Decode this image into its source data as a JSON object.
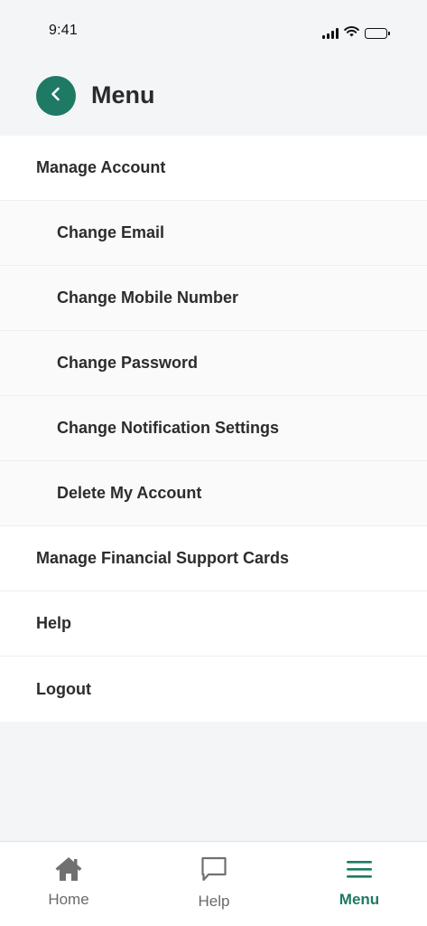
{
  "status_bar": {
    "time": "9:41"
  },
  "header": {
    "title": "Menu"
  },
  "menu": {
    "items": [
      {
        "label": "Manage Account",
        "level": "top"
      },
      {
        "label": "Change Email",
        "level": "sub"
      },
      {
        "label": "Change Mobile Number",
        "level": "sub"
      },
      {
        "label": "Change Password",
        "level": "sub"
      },
      {
        "label": "Change Notification Settings",
        "level": "sub"
      },
      {
        "label": "Delete My Account",
        "level": "sub"
      },
      {
        "label": "Manage Financial Support Cards",
        "level": "top"
      },
      {
        "label": "Help",
        "level": "top"
      },
      {
        "label": "Logout",
        "level": "top"
      }
    ]
  },
  "bottom_nav": {
    "tabs": [
      {
        "label": "Home",
        "icon": "home-icon",
        "active": false
      },
      {
        "label": "Help",
        "icon": "chat-bubble-icon",
        "active": false
      },
      {
        "label": "Menu",
        "icon": "hamburger-menu-icon",
        "active": true
      }
    ]
  },
  "colors": {
    "accent": "#1e7a64",
    "background": "#f4f5f6",
    "inactive_icon": "#707070"
  }
}
